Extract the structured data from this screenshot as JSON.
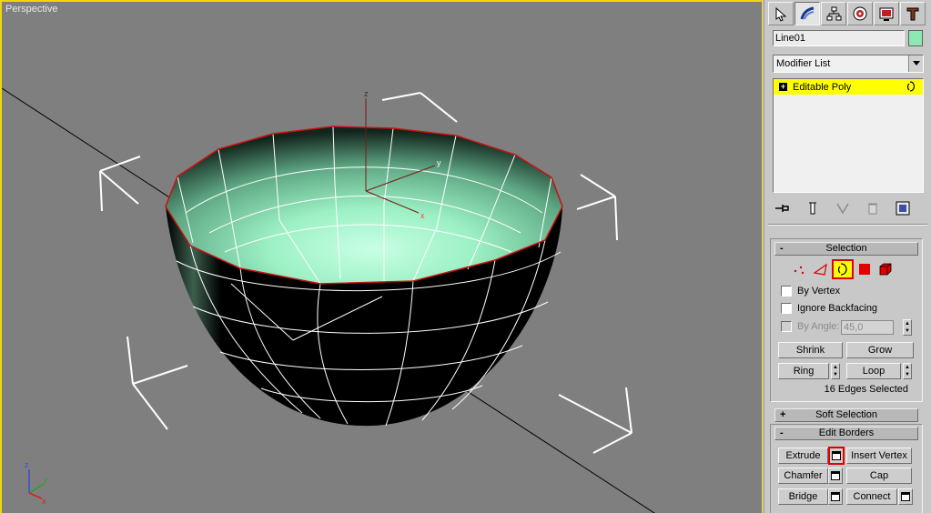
{
  "viewport": {
    "label": "Perspective",
    "gizmo_labels": {
      "z": "z",
      "y": "y",
      "x": "x"
    },
    "corner_axis": {
      "z": "z",
      "y": "y",
      "x": "x"
    }
  },
  "panel": {
    "tabs": [
      "create-icon",
      "modify-icon",
      "hierarchy-icon",
      "motion-icon",
      "display-icon",
      "utilities-icon"
    ],
    "object_name": "Line01",
    "object_color": "#8ee8b4",
    "modifier_list": "Modifier List",
    "stack": {
      "item": "Editable Poly"
    }
  },
  "selection": {
    "title": "Selection",
    "by_vertex": "By Vertex",
    "ignore_backfacing": "Ignore Backfacing",
    "by_angle": "By Angle:",
    "angle_value": "45,0",
    "shrink": "Shrink",
    "grow": "Grow",
    "ring": "Ring",
    "loop": "Loop",
    "status": "16 Edges Selected"
  },
  "soft_selection": {
    "title": "Soft Selection"
  },
  "edit_borders": {
    "title": "Edit Borders",
    "extrude": "Extrude",
    "insert_vertex": "Insert Vertex",
    "chamfer": "Chamfer",
    "cap": "Cap",
    "bridge": "Bridge",
    "connect": "Connect"
  }
}
